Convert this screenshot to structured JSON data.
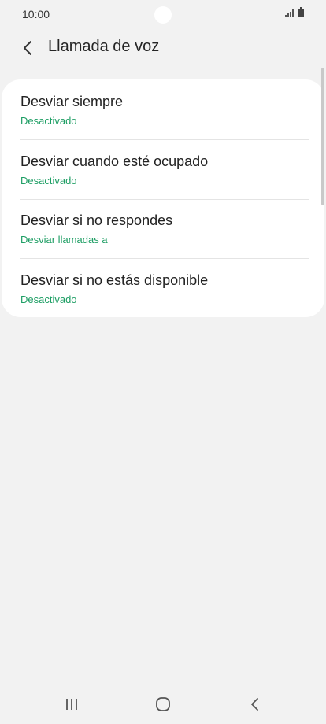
{
  "status_bar": {
    "time": "10:00",
    "icons": [
      "signal-icon",
      "battery-icon"
    ]
  },
  "header": {
    "back_icon": "chevron-left-icon",
    "title": "Llamada de voz"
  },
  "forwarding_options": [
    {
      "title": "Desviar siempre",
      "status": "Desactivado"
    },
    {
      "title": "Desviar cuando esté ocupado",
      "status": "Desactivado"
    },
    {
      "title": "Desviar si no respondes",
      "status": "Desviar llamadas a"
    },
    {
      "title": "Desviar si no estás disponible",
      "status": "Desactivado"
    }
  ],
  "colors": {
    "background": "#f2f2f2",
    "card": "#ffffff",
    "accent_status": "#1e9e64",
    "text": "#222222"
  },
  "navigation_bar": {
    "icons": [
      "recent-apps-icon",
      "home-icon",
      "back-icon"
    ]
  }
}
